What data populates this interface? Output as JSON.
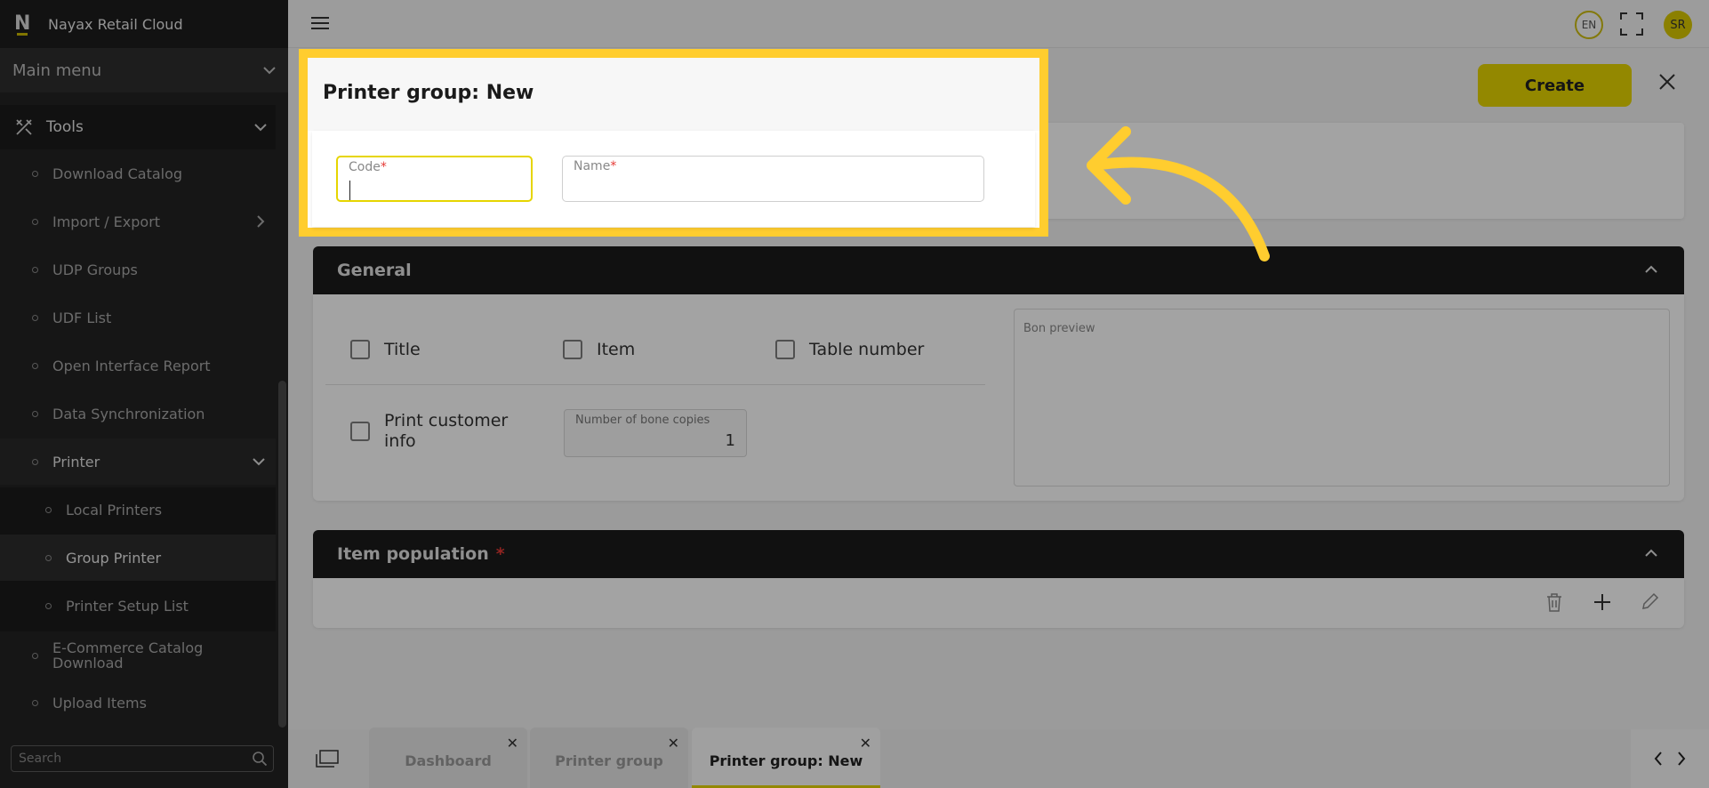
{
  "app": {
    "title": "Nayax Retail Cloud",
    "logo_letter": "N"
  },
  "sidebar": {
    "main_menu_label": "Main menu",
    "tools_label": "Tools",
    "items": [
      {
        "label": "Download Catalog"
      },
      {
        "label": "Import / Export"
      },
      {
        "label": "UDP Groups"
      },
      {
        "label": "UDF List"
      },
      {
        "label": "Open Interface Report"
      },
      {
        "label": "Data Synchronization"
      },
      {
        "label": "Printer"
      },
      {
        "label": "Local Printers"
      },
      {
        "label": "Group Printer"
      },
      {
        "label": "Printer Setup List"
      },
      {
        "label": "E-Commerce Catalog Download"
      },
      {
        "label": "Upload Items"
      }
    ],
    "search_placeholder": "Search"
  },
  "topbar": {
    "language": "EN",
    "user_initials": "SR"
  },
  "page": {
    "title": "Printer group: New",
    "create_label": "Create",
    "code_label": "Code",
    "name_label": "Name",
    "required_mark": "*"
  },
  "general": {
    "title": "General",
    "checkboxes": {
      "title": "Title",
      "item": "Item",
      "table_number": "Table number",
      "print_customer_info": "Print customer info"
    },
    "copies_label": "Number of bone copies",
    "copies_value": "1",
    "preview_label": "Bon preview"
  },
  "item_population": {
    "title": "Item population",
    "required_mark": "*"
  },
  "tabs": [
    {
      "label": "Dashboard",
      "close": "✕"
    },
    {
      "label": "Printer group",
      "close": "✕"
    },
    {
      "label": "Printer group: New",
      "close": "✕"
    }
  ],
  "colors": {
    "accent": "#e6d500",
    "highlight": "#ffcd2f",
    "sidebar": "#232323"
  }
}
